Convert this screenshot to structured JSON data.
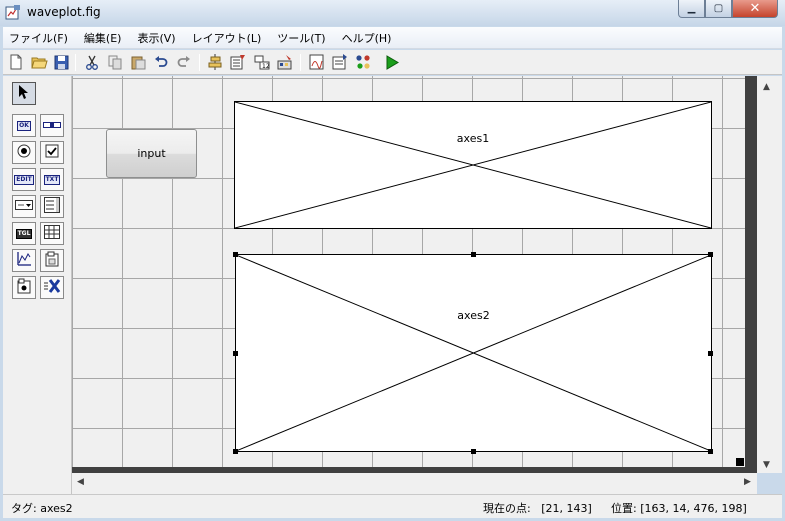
{
  "window": {
    "title": "waveplot.fig",
    "icons": {
      "app": "figure-app-icon",
      "minimize": "minimize-icon",
      "maximize": "maximize-icon",
      "close": "close-icon"
    }
  },
  "menu": [
    {
      "label": "ファイル(F)"
    },
    {
      "label": "編集(E)"
    },
    {
      "label": "表示(V)"
    },
    {
      "label": "レイアウト(L)"
    },
    {
      "label": "ツール(T)"
    },
    {
      "label": "ヘルプ(H)"
    }
  ],
  "toolbar": [
    "new-file-icon",
    "open-folder-icon",
    "save-icon",
    "cut-icon",
    "copy-icon",
    "paste-icon",
    "undo-icon",
    "redo-icon",
    "align-objects-icon",
    "menu-editor-icon",
    "tab-order-editor-icon",
    "toolbar-editor-icon",
    "m-file-editor-icon",
    "property-inspector-icon",
    "object-browser-icon",
    "run-icon"
  ],
  "palette": [
    {
      "name": "select-tool",
      "tag": ""
    },
    {
      "name": "push-button-tool",
      "tag": "OK"
    },
    {
      "name": "slider-tool",
      "tag": ""
    },
    {
      "name": "radio-button-tool",
      "tag": ""
    },
    {
      "name": "checkbox-tool",
      "tag": ""
    },
    {
      "name": "edit-text-tool",
      "tag": "EDIT"
    },
    {
      "name": "static-text-tool",
      "tag": "TXT"
    },
    {
      "name": "popup-menu-tool",
      "tag": ""
    },
    {
      "name": "listbox-tool",
      "tag": ""
    },
    {
      "name": "toggle-button-tool",
      "tag": "TGL"
    },
    {
      "name": "table-tool",
      "tag": ""
    },
    {
      "name": "axes-tool",
      "tag": ""
    },
    {
      "name": "panel-tool",
      "tag": ""
    },
    {
      "name": "button-group-tool",
      "tag": ""
    },
    {
      "name": "activex-control-tool",
      "tag": ""
    }
  ],
  "canvas": {
    "button_label": "input",
    "axes1_label": "axes1",
    "axes2_label": "axes2"
  },
  "status": {
    "tag": "タグ: axes2",
    "current_point": "現在の点:   [21, 143]",
    "position": "位置: [163, 14, 476, 198]"
  },
  "colors": {
    "titlebar": "#c6d6e8",
    "close": "#c5432c",
    "run_green": "#1a9e1a",
    "edge": "#404040"
  }
}
